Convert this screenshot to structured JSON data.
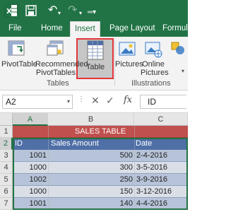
{
  "ribbon_tabs": [
    {
      "label": "File"
    },
    {
      "label": "Home"
    },
    {
      "label": "Insert"
    },
    {
      "label": "Page Layout"
    },
    {
      "label": "Formulas"
    }
  ],
  "active_tab": "Insert",
  "ribbon": {
    "pivottable": "PivotTable",
    "recommended_line1": "Recommended",
    "recommended_line2": "PivotTables",
    "table": "Table",
    "pictures": "Pictures",
    "online_line1": "Online",
    "online_line2": "Pictures",
    "group_tables": "Tables",
    "group_illustrations": "Illustrations"
  },
  "formula_bar": {
    "name_box": "A2",
    "content": "ID"
  },
  "grid": {
    "columns": [
      "A",
      "B",
      "C"
    ],
    "rows": [
      "1",
      "2",
      "3",
      "4",
      "5",
      "6",
      "7"
    ],
    "title": "SALES TABLE",
    "headers": [
      "ID",
      "Sales Amount",
      "Date"
    ],
    "data": [
      [
        "1001",
        "500",
        "2-4-2016"
      ],
      [
        "1000",
        "300",
        "3-5-2016"
      ],
      [
        "1002",
        "250",
        "3-9-2016"
      ],
      [
        "1000",
        "150",
        "3-12-2016"
      ],
      [
        "1001",
        "140",
        "4-4-2016"
      ]
    ]
  },
  "colors": {
    "excel_green": "#217346",
    "title_row": "#c0504d",
    "header_row": "#4f6fa6",
    "band_dark": "#b7c3d8",
    "band_light": "#d9dee7",
    "highlight_box": "#e2363a"
  }
}
